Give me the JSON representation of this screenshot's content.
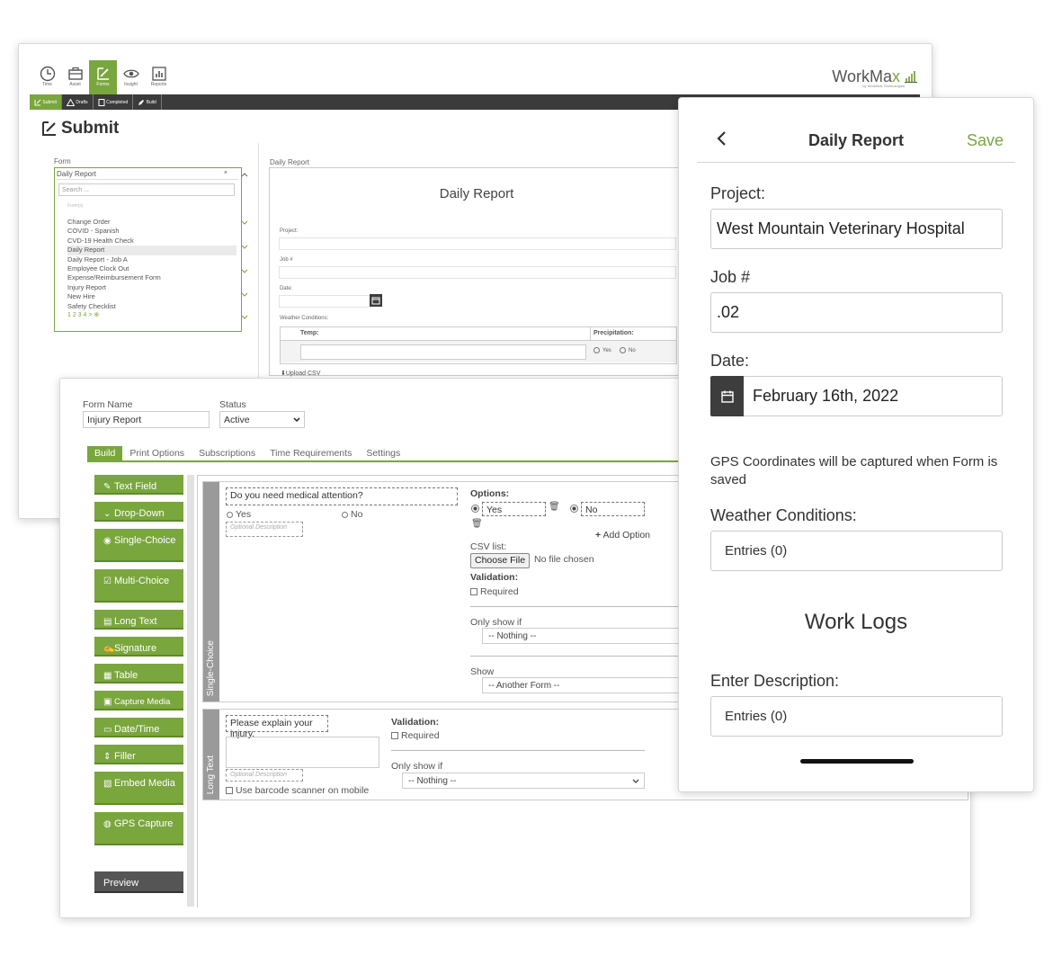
{
  "submit_window": {
    "top_icons": [
      {
        "label": "Time",
        "icon": "clock-icon"
      },
      {
        "label": "Asset",
        "icon": "briefcase-icon"
      },
      {
        "label": "Forms",
        "icon": "forms-icon",
        "active": true
      },
      {
        "label": "Insight",
        "icon": "eye-icon"
      },
      {
        "label": "Reports",
        "icon": "chart-icon"
      }
    ],
    "logo": {
      "text_main": "WorkMa",
      "text_accent": "x",
      "tagline": "by WorkMax Technologies"
    },
    "subtabs": [
      "Submit",
      "Drafts",
      "Completed",
      "Build"
    ],
    "page_title": "Submit",
    "form_label": "Form",
    "form_selected": "Daily Report",
    "search_placeholder": "Search ...",
    "group_label": "Form(s)",
    "form_items": [
      "Change Order",
      "COVID - Spanish",
      "CVD-19 Health Check",
      "Daily Report",
      "Daily Report - Job A",
      "Employee Clock Out",
      "Expense/Reimbursement Form",
      "Injury Report",
      "New Hire",
      "Safety Checklist"
    ],
    "pager": "1  2  3  4 >",
    "preview": {
      "breadcrumb": "Daily Report",
      "title": "Daily Report",
      "project_label": "Project:",
      "job_label": "Job #",
      "date_label": "Date:",
      "weather_label": "Weather Conditions:",
      "col_temp": "Temp:",
      "col_precip": "Precipitation:",
      "opt_yes": "Yes",
      "opt_no": "No",
      "upload_csv": "Upload CSV"
    }
  },
  "builder_window": {
    "form_name_label": "Form Name",
    "form_name_value": "Injury Report",
    "status_label": "Status",
    "status_value": "Active",
    "tabs": [
      "Build",
      "Print Options",
      "Subscriptions",
      "Time Requirements",
      "Settings"
    ],
    "palette": [
      {
        "label": "Text Field",
        "icon": "pencil-icon"
      },
      {
        "label": "Drop-Down",
        "icon": "chevron-down-icon"
      },
      {
        "label": "Single-Choice",
        "icon": "radio-icon"
      },
      {
        "label": "Multi-Choice",
        "icon": "checkbox-icon"
      },
      {
        "label": "Long Text",
        "icon": "longtext-icon"
      },
      {
        "label": "Signature",
        "icon": "signature-icon"
      },
      {
        "label": "Table",
        "icon": "table-icon"
      },
      {
        "label": "Capture Media",
        "icon": "media-icon"
      },
      {
        "label": "Date/Time",
        "icon": "calendar-icon"
      },
      {
        "label": "Filler",
        "icon": "filler-icon"
      },
      {
        "label": "Embed Media",
        "icon": "embed-icon"
      },
      {
        "label": "GPS Capture",
        "icon": "globe-icon"
      }
    ],
    "preview_button": "Preview",
    "single_choice": {
      "side_label": "Single-Choice",
      "question": "Do you need medical attention?",
      "choice_yes": "Yes",
      "choice_no": "No",
      "description_placeholder": "Optional Description",
      "options_label": "Options:",
      "option_yes": "Yes",
      "option_no": "No",
      "add_option": "Add Option",
      "csv_label": "CSV list:",
      "choose_file": "Choose File",
      "no_file": "No file chosen",
      "validation_label": "Validation:",
      "required_label": "Required",
      "only_show_if_label": "Only show if",
      "only_show_if_value": "-- Nothing --",
      "show_label": "Show",
      "show_value": "-- Another Form --"
    },
    "long_text": {
      "side_label": "Long Text",
      "question": "Please explain your injury.",
      "description_placeholder": "Optional Description",
      "barcode_label": "Use barcode scanner on mobile",
      "validation_label": "Validation:",
      "required_label": "Required",
      "only_show_if_label": "Only show if",
      "only_show_if_value": "-- Nothing --"
    }
  },
  "mobile_window": {
    "title": "Daily Report",
    "save": "Save",
    "project_label": "Project:",
    "project_value": "West Mountain Veterinary Hospital",
    "job_label": "Job #",
    "job_value": ".02",
    "date_label": "Date:",
    "date_value": "February 16th, 2022",
    "gps_note": "GPS Coordinates will be captured when Form is saved",
    "weather_label": "Weather Conditions:",
    "weather_value": "Entries (0)",
    "section_title": "Work Logs",
    "description_label": "Enter Description:",
    "description_value": "Entries (0)"
  },
  "colors": {
    "accent": "#7aa63e",
    "dark": "#3b3b3b"
  }
}
